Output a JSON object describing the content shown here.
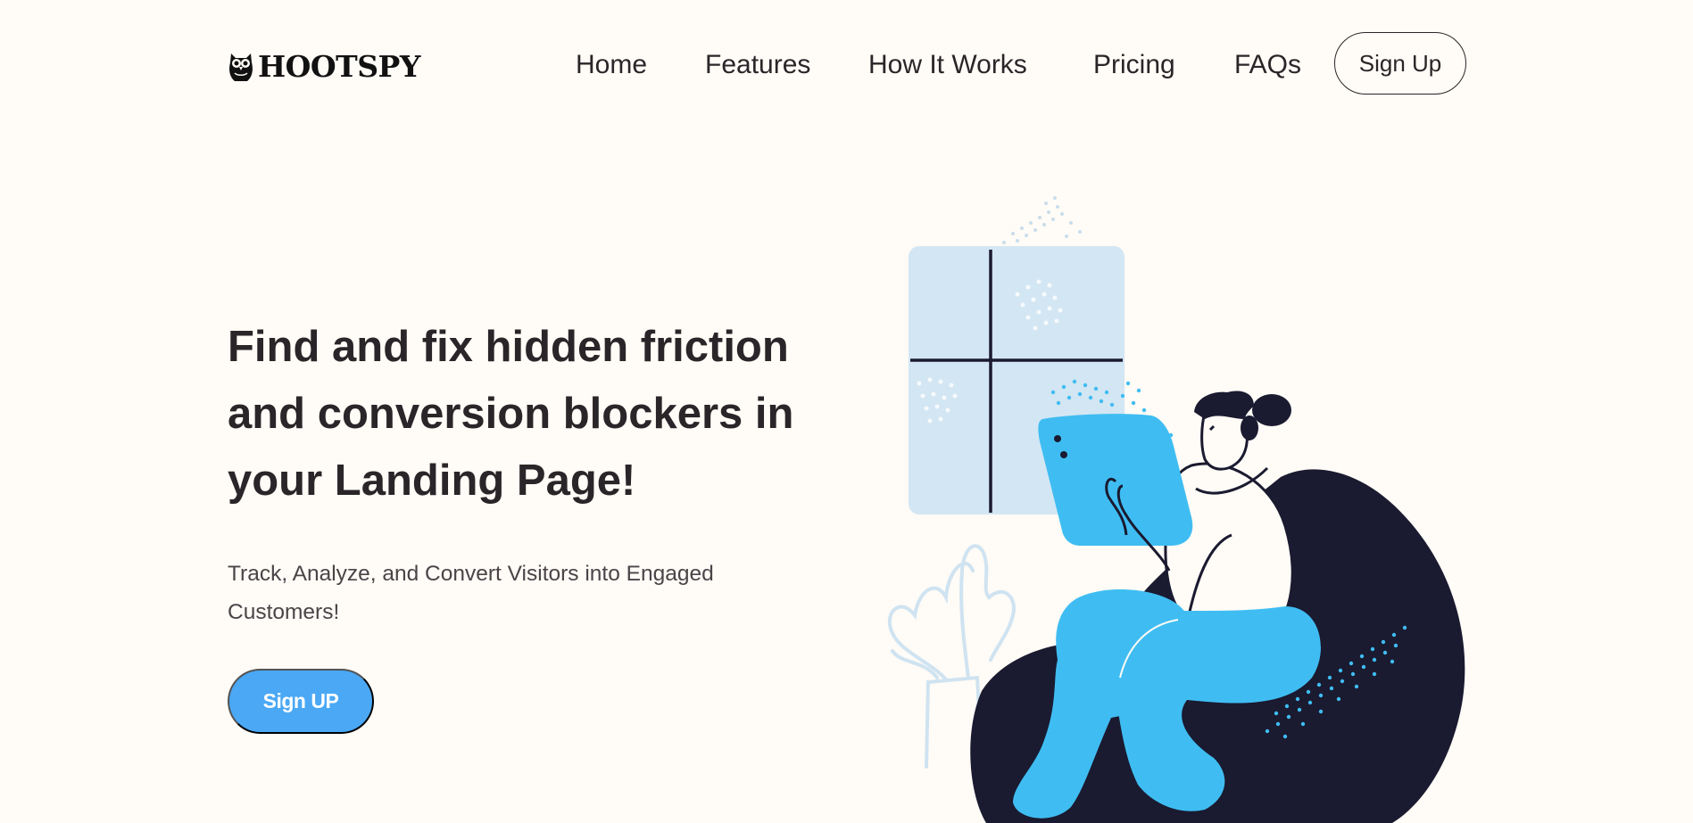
{
  "brand": {
    "name": "HOOTSPY",
    "logo_icon": "owl-icon"
  },
  "nav": {
    "items": [
      {
        "label": "Home"
      },
      {
        "label": "Features"
      },
      {
        "label": "How It Works"
      },
      {
        "label": "Pricing"
      },
      {
        "label": "FAQs"
      }
    ],
    "signup_label": "Sign Up"
  },
  "hero": {
    "title_lines": [
      "Find and fix hidden friction",
      "and conversion blockers in",
      "your Landing Page!"
    ],
    "subtitle_lines": [
      "Track, Analyze, and Convert Visitors into Engaged",
      "Customers!"
    ],
    "cta_label": "Sign UP"
  },
  "colors": {
    "background": "#fffbf6",
    "accent_blue": "#4aa8f5",
    "figure_blue": "#3fbdf2",
    "navy": "#1a1a30",
    "window_blue": "#d3e6f3",
    "text_dark": "#2a2528"
  },
  "illustration": {
    "icon": "woman-on-beanbag-with-tablet-illustration"
  }
}
